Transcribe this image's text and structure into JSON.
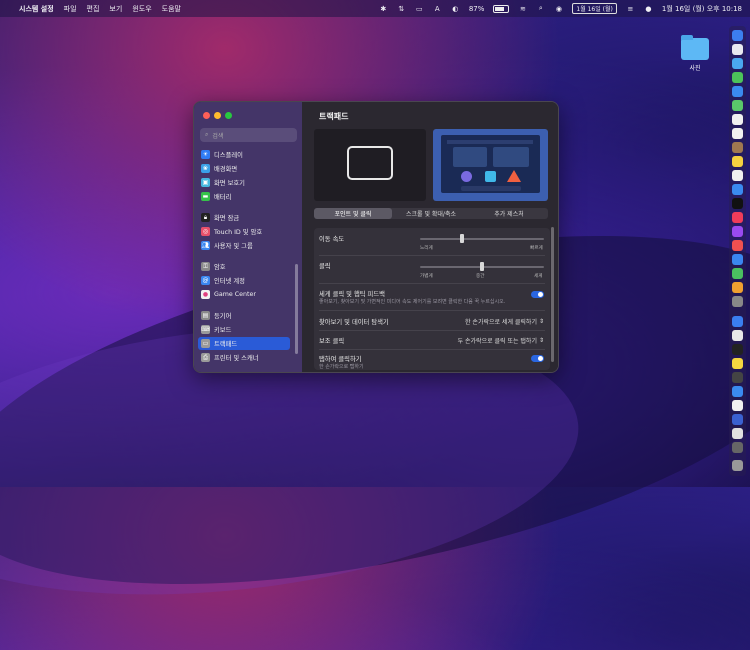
{
  "menubar": {
    "app_name": "시스템 설정",
    "menus": [
      "파일",
      "편집",
      "보기",
      "윈도우",
      "도움말"
    ],
    "battery_percent": "87%",
    "date_badge": "1월 16일 (월)",
    "clock": "1월 16일 (월) 오후 10:18"
  },
  "desktop": {
    "folder_label": "사진"
  },
  "sidebar": {
    "search_placeholder": "검색",
    "items": [
      {
        "label": "디스플레이",
        "color": "#2f7bf5",
        "icon": "display-icon"
      },
      {
        "label": "배경화면",
        "color": "#3aa0e8",
        "icon": "wallpaper-icon"
      },
      {
        "label": "화면 보호기",
        "color": "#46b8e0",
        "icon": "screensaver-icon"
      },
      {
        "label": "배터리",
        "color": "#36c24a",
        "icon": "battery-icon"
      },
      {
        "label": "화면 잠금",
        "color": "#222222",
        "icon": "lock-icon"
      },
      {
        "label": "Touch ID 및 암호",
        "color": "#e8506a",
        "icon": "fingerprint-icon"
      },
      {
        "label": "사용자 및 그룹",
        "color": "#3a86f0",
        "icon": "users-icon"
      },
      {
        "label": "암호",
        "color": "#8a8a8a",
        "icon": "key-icon"
      },
      {
        "label": "인터넷 계정",
        "color": "#3a86f0",
        "icon": "at-icon"
      },
      {
        "label": "Game Center",
        "color": "#f2f2f2",
        "icon": "gamecenter-icon"
      },
      {
        "label": "등기어",
        "color": "#8a8a8a",
        "icon": "wallet-icon"
      },
      {
        "label": "키보드",
        "color": "#9a9a9a",
        "icon": "keyboard-icon"
      },
      {
        "label": "트랙패드",
        "color": "#9a9a9a",
        "icon": "trackpad-icon"
      },
      {
        "label": "프린터 및 스캐너",
        "color": "#9a9a9a",
        "icon": "printer-icon"
      }
    ],
    "selected_index": 12
  },
  "content": {
    "title": "트랙패드",
    "tabs": [
      "포인트 및 클릭",
      "스크롤 및 확대/축소",
      "추가 제스처"
    ],
    "active_tab": 0,
    "tracking_speed": {
      "label": "이동 속도",
      "min_label": "느리게",
      "max_label": "빠르게",
      "value": 0.34
    },
    "click": {
      "label": "클릭",
      "labels": [
        "가볍게",
        "중간",
        "세게"
      ],
      "value": 0.5
    },
    "force_click": {
      "label": "세게 클릭 및 햅틱 피드백",
      "desc": "좋아보기, 찾아보기 및 가변적인 미디어 속도 제어기를 보려면 클릭한 다음 꾹 누르십시오.",
      "on": true
    },
    "lookup": {
      "label": "찾아보기 및 데이터 탐색기",
      "value": "한 손가락으로 세게 클릭하기"
    },
    "secondary_click": {
      "label": "보조 클릭",
      "value": "두 손가락으로 클릭 또는 탭하기"
    },
    "tap_to_click": {
      "label": "탭하여 클릭하기",
      "desc": "한 손가락으로 탭하기",
      "on": true
    }
  }
}
